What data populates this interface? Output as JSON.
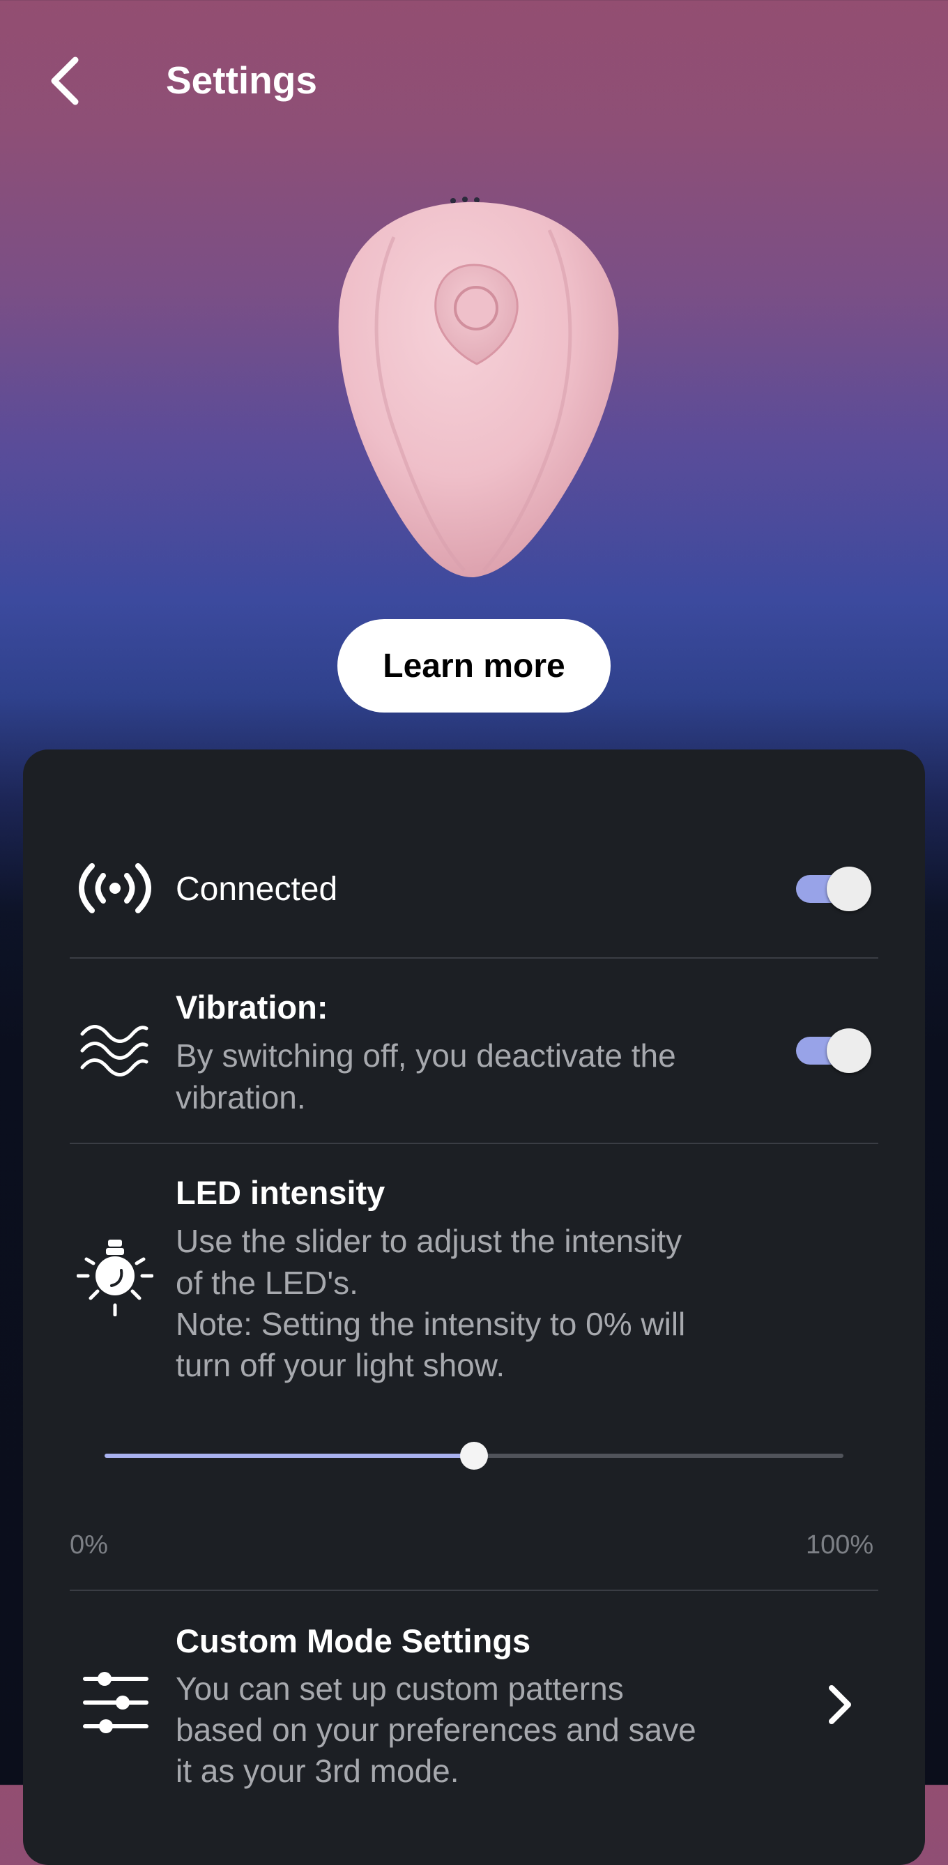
{
  "header": {
    "back_icon": "chevron-left-icon",
    "title": "Settings"
  },
  "hero": {
    "product_image": "product-illustration",
    "learn_more_label": "Learn more"
  },
  "settings": {
    "connected": {
      "icon": "broadcast-icon",
      "label": "Connected",
      "enabled": true
    },
    "vibration": {
      "icon": "waves-icon",
      "title": "Vibration:",
      "description_line1": "By switching off, you deactivate the",
      "description_line2": "vibration.",
      "enabled": true
    },
    "led_intensity": {
      "icon": "lightbulb-icon",
      "title": "LED intensity",
      "description_line1": "Use the slider to adjust the intensity",
      "description_line2": "of the LED's.",
      "description_line3": "Note: Setting the intensity to 0% will",
      "description_line4": "turn off your light show.",
      "value_fraction": 0.5,
      "min_label": "0%",
      "max_label": "100%"
    },
    "custom_mode": {
      "icon": "sliders-icon",
      "title": "Custom Mode Settings",
      "description_line1": "You can set up custom patterns",
      "description_line2": "based on your preferences and save",
      "description_line3": "it as your 3rd mode.",
      "chevron_icon": "chevron-right-icon"
    }
  },
  "colors": {
    "accent": "#98a3e8",
    "panel": "#1c1f24",
    "secondary_text": "#a7a9ae"
  }
}
